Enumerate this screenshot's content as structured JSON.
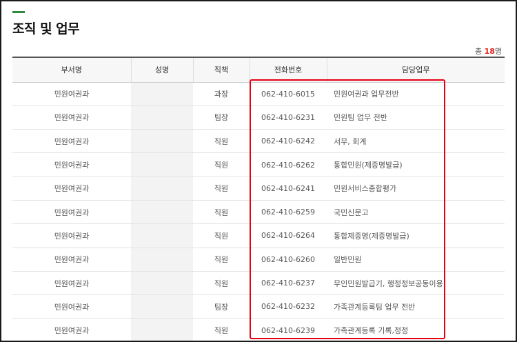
{
  "page": {
    "title": "조직 및 업무"
  },
  "total": {
    "prefix": "총",
    "count": "18",
    "suffix": "명"
  },
  "table": {
    "headers": [
      "부서명",
      "성명",
      "직책",
      "전화번호",
      "담당업무"
    ],
    "rows": [
      {
        "dept": "민원여권과",
        "name": "",
        "position": "과장",
        "phone": "062-410-6015",
        "duty": "민원여권과 업무전반"
      },
      {
        "dept": "민원여권과",
        "name": "",
        "position": "팀장",
        "phone": "062-410-6231",
        "duty": "민원팀 업무 전반"
      },
      {
        "dept": "민원여권과",
        "name": "",
        "position": "직원",
        "phone": "062-410-6242",
        "duty": "서무, 회계"
      },
      {
        "dept": "민원여권과",
        "name": "",
        "position": "직원",
        "phone": "062-410-6262",
        "duty": "통합민원(제증명발급)"
      },
      {
        "dept": "민원여권과",
        "name": "",
        "position": "직원",
        "phone": "062-410-6241",
        "duty": "민원서비스종합평가"
      },
      {
        "dept": "민원여권과",
        "name": "",
        "position": "직원",
        "phone": "062-410-6259",
        "duty": "국민신문고"
      },
      {
        "dept": "민원여권과",
        "name": "",
        "position": "직원",
        "phone": "062-410-6264",
        "duty": "통합제증명(제증명발급)"
      },
      {
        "dept": "민원여권과",
        "name": "",
        "position": "직원",
        "phone": "062-410-6260",
        "duty": "일반민원"
      },
      {
        "dept": "민원여권과",
        "name": "",
        "position": "직원",
        "phone": "062-410-6237",
        "duty": "무인민원발급기, 행정정보공동이용"
      },
      {
        "dept": "민원여권과",
        "name": "",
        "position": "팀장",
        "phone": "062-410-6232",
        "duty": "가족관계등록팀 업무 전반"
      },
      {
        "dept": "민원여권과",
        "name": "",
        "position": "직원",
        "phone": "062-410-6239",
        "duty": "가족관계등록 기록,정정"
      }
    ]
  },
  "colors": {
    "accent_green": "#2d8a3e",
    "highlight_red": "#e60012",
    "count_red": "#e0251b"
  }
}
